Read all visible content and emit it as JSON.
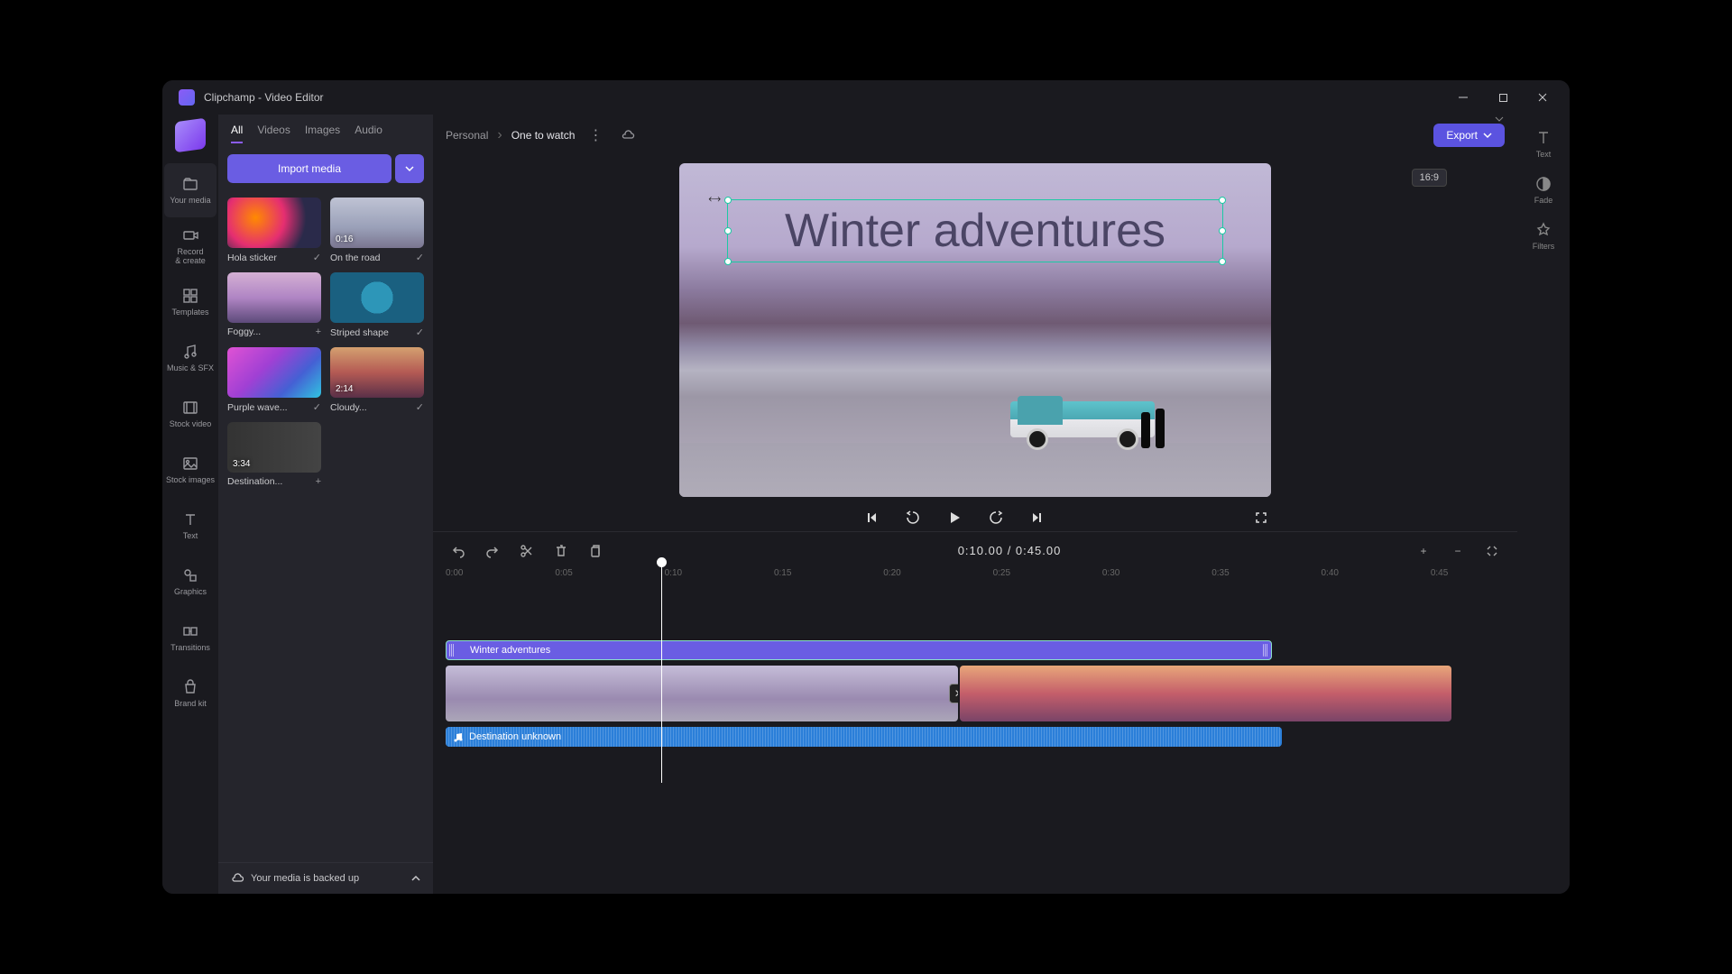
{
  "titlebar": {
    "title": "Clipchamp - Video Editor"
  },
  "rail": {
    "items": [
      {
        "label": "Your media"
      },
      {
        "label": "Record\n& create"
      },
      {
        "label": "Templates"
      },
      {
        "label": "Music & SFX"
      },
      {
        "label": "Stock video"
      },
      {
        "label": "Stock images"
      },
      {
        "label": "Text"
      },
      {
        "label": "Graphics"
      },
      {
        "label": "Transitions"
      },
      {
        "label": "Brand kit"
      }
    ]
  },
  "tabs": {
    "items": [
      "All",
      "Videos",
      "Images",
      "Audio"
    ]
  },
  "import_label": "Import media",
  "media": [
    {
      "name": "Hola sticker",
      "dur": "",
      "thumb": "th-hola",
      "used": true
    },
    {
      "name": "On the road",
      "dur": "0:16",
      "thumb": "th-road",
      "used": true
    },
    {
      "name": "Foggy...",
      "dur": "",
      "thumb": "th-foggy",
      "used": false
    },
    {
      "name": "Striped shape",
      "dur": "",
      "thumb": "th-stripe",
      "used": true
    },
    {
      "name": "Purple wave...",
      "dur": "",
      "thumb": "th-wave",
      "used": true
    },
    {
      "name": "Cloudy...",
      "dur": "2:14",
      "thumb": "th-cloudy",
      "used": true
    },
    {
      "name": "Destination...",
      "dur": "3:34",
      "thumb": "th-dest",
      "used": false
    }
  ],
  "backup": "Your media is backed up",
  "breadcrumb": {
    "root": "Personal",
    "current": "One to watch"
  },
  "export_label": "Export",
  "aspect": "16:9",
  "proprail": [
    {
      "label": "Text"
    },
    {
      "label": "Fade"
    },
    {
      "label": "Filters"
    }
  ],
  "overlay_text": "Winter adventures",
  "timecode": {
    "current": "0:10.00",
    "sep": " / ",
    "total": "0:45.00"
  },
  "ruler": [
    "0:00",
    "0:05",
    "0:10",
    "0:15",
    "0:20",
    "0:25",
    "0:30",
    "0:35",
    "0:40",
    "0:45"
  ],
  "tracks": {
    "text_clip": "Winter adventures",
    "audio_clip": "Destination unknown"
  },
  "playhead_pct": 20.4
}
